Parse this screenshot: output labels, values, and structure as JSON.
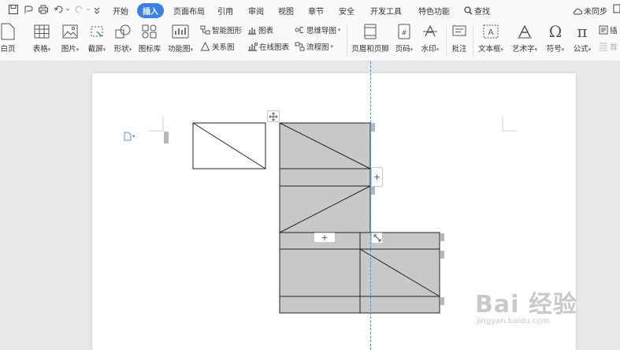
{
  "menubar": {
    "items": [
      {
        "label": "开始"
      },
      {
        "label": "插入",
        "active": true
      },
      {
        "label": "页面布局"
      },
      {
        "label": "引用"
      },
      {
        "label": "审阅"
      },
      {
        "label": "视图"
      },
      {
        "label": "章节"
      },
      {
        "label": "安全"
      },
      {
        "label": "开发工具"
      },
      {
        "label": "特色功能"
      }
    ],
    "search_label": "查找",
    "sync_label": "未同步"
  },
  "ribbon": {
    "blank_page": "白页",
    "table": "表格",
    "picture": "图片",
    "screenshot": "截屏",
    "shape": "形状",
    "icon_library": "图标库",
    "function_chart": "功能图",
    "smart_shape": "智能图形",
    "chart": "图表",
    "mind_map": "思维导图",
    "relation_chart": "关系图",
    "online_chart": "在线图表",
    "flowchart": "流程图",
    "header_footer": "页眉和页脚",
    "page_number": "页码",
    "watermark": "水印",
    "comment": "批注",
    "text_box": "文本框",
    "word_art": "艺术字",
    "symbol": "符号",
    "formula": "公式",
    "insert_partial": "插",
    "first_partial": "首"
  },
  "handles": {
    "add_row_symbol": "+",
    "add_col_symbol": "+"
  },
  "watermark": {
    "main": "Bai 经验",
    "sub": "jingyan.baidu.com"
  },
  "colors": {
    "accent": "#3a80e6",
    "cell_fill": "#c8c8c8",
    "guide": "#4a90d9"
  }
}
